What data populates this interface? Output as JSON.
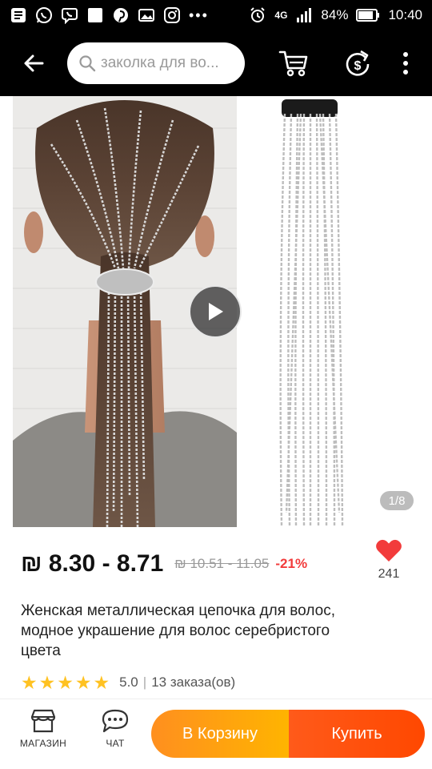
{
  "status_bar": {
    "battery": "84%",
    "time": "10:40",
    "network": "4G",
    "icons": [
      "messages-icon",
      "whatsapp-icon",
      "viber-icon",
      "notification-square-icon",
      "pinterest-icon",
      "gallery-icon",
      "instagram-icon",
      "more-dots-icon",
      "alarm-icon",
      "network-4g-icon",
      "signal-icon",
      "battery-icon"
    ]
  },
  "header": {
    "search_placeholder": "заколка для во...",
    "icons": [
      "back-arrow-icon",
      "search-icon",
      "cart-icon",
      "share-dollar-icon",
      "more-vertical-icon"
    ]
  },
  "gallery": {
    "counter": "1/8",
    "current_image": 1,
    "total_images": 8,
    "has_video": true
  },
  "price": {
    "current": "₪ 8.30 - 8.71",
    "old": "₪ 10.51 - 11.05",
    "discount": "-21%"
  },
  "wishlist": {
    "count": "241",
    "color": "#f23b3b"
  },
  "product": {
    "title": "Женская металлическая цепочка для волос, модное украшение для волос серебристого цвета"
  },
  "rating": {
    "stars": 5,
    "value": "5.0",
    "separator": "|",
    "orders": "13 заказа(ов)",
    "star_color": "#ffc222"
  },
  "bottom_bar": {
    "store_label": "МАГАЗИН",
    "chat_label": "ЧАТ",
    "cart_label": "В Корзину",
    "buy_label": "Купить",
    "cart_color": "#ffa000",
    "buy_color": "#ff5000"
  }
}
